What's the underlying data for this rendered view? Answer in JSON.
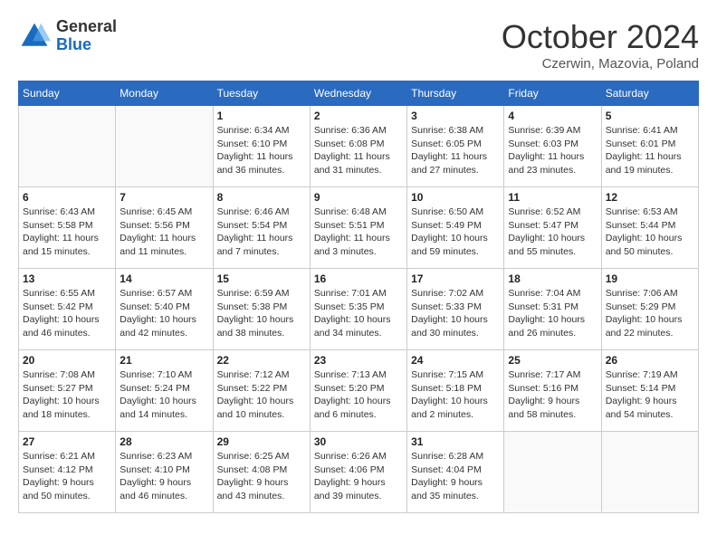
{
  "logo": {
    "general": "General",
    "blue": "Blue"
  },
  "header": {
    "month": "October 2024",
    "location": "Czerwin, Mazovia, Poland"
  },
  "weekdays": [
    "Sunday",
    "Monday",
    "Tuesday",
    "Wednesday",
    "Thursday",
    "Friday",
    "Saturday"
  ],
  "weeks": [
    [
      {
        "day": "",
        "info": ""
      },
      {
        "day": "",
        "info": ""
      },
      {
        "day": "1",
        "info": "Sunrise: 6:34 AM\nSunset: 6:10 PM\nDaylight: 11 hours and 36 minutes."
      },
      {
        "day": "2",
        "info": "Sunrise: 6:36 AM\nSunset: 6:08 PM\nDaylight: 11 hours and 31 minutes."
      },
      {
        "day": "3",
        "info": "Sunrise: 6:38 AM\nSunset: 6:05 PM\nDaylight: 11 hours and 27 minutes."
      },
      {
        "day": "4",
        "info": "Sunrise: 6:39 AM\nSunset: 6:03 PM\nDaylight: 11 hours and 23 minutes."
      },
      {
        "day": "5",
        "info": "Sunrise: 6:41 AM\nSunset: 6:01 PM\nDaylight: 11 hours and 19 minutes."
      }
    ],
    [
      {
        "day": "6",
        "info": "Sunrise: 6:43 AM\nSunset: 5:58 PM\nDaylight: 11 hours and 15 minutes."
      },
      {
        "day": "7",
        "info": "Sunrise: 6:45 AM\nSunset: 5:56 PM\nDaylight: 11 hours and 11 minutes."
      },
      {
        "day": "8",
        "info": "Sunrise: 6:46 AM\nSunset: 5:54 PM\nDaylight: 11 hours and 7 minutes."
      },
      {
        "day": "9",
        "info": "Sunrise: 6:48 AM\nSunset: 5:51 PM\nDaylight: 11 hours and 3 minutes."
      },
      {
        "day": "10",
        "info": "Sunrise: 6:50 AM\nSunset: 5:49 PM\nDaylight: 10 hours and 59 minutes."
      },
      {
        "day": "11",
        "info": "Sunrise: 6:52 AM\nSunset: 5:47 PM\nDaylight: 10 hours and 55 minutes."
      },
      {
        "day": "12",
        "info": "Sunrise: 6:53 AM\nSunset: 5:44 PM\nDaylight: 10 hours and 50 minutes."
      }
    ],
    [
      {
        "day": "13",
        "info": "Sunrise: 6:55 AM\nSunset: 5:42 PM\nDaylight: 10 hours and 46 minutes."
      },
      {
        "day": "14",
        "info": "Sunrise: 6:57 AM\nSunset: 5:40 PM\nDaylight: 10 hours and 42 minutes."
      },
      {
        "day": "15",
        "info": "Sunrise: 6:59 AM\nSunset: 5:38 PM\nDaylight: 10 hours and 38 minutes."
      },
      {
        "day": "16",
        "info": "Sunrise: 7:01 AM\nSunset: 5:35 PM\nDaylight: 10 hours and 34 minutes."
      },
      {
        "day": "17",
        "info": "Sunrise: 7:02 AM\nSunset: 5:33 PM\nDaylight: 10 hours and 30 minutes."
      },
      {
        "day": "18",
        "info": "Sunrise: 7:04 AM\nSunset: 5:31 PM\nDaylight: 10 hours and 26 minutes."
      },
      {
        "day": "19",
        "info": "Sunrise: 7:06 AM\nSunset: 5:29 PM\nDaylight: 10 hours and 22 minutes."
      }
    ],
    [
      {
        "day": "20",
        "info": "Sunrise: 7:08 AM\nSunset: 5:27 PM\nDaylight: 10 hours and 18 minutes."
      },
      {
        "day": "21",
        "info": "Sunrise: 7:10 AM\nSunset: 5:24 PM\nDaylight: 10 hours and 14 minutes."
      },
      {
        "day": "22",
        "info": "Sunrise: 7:12 AM\nSunset: 5:22 PM\nDaylight: 10 hours and 10 minutes."
      },
      {
        "day": "23",
        "info": "Sunrise: 7:13 AM\nSunset: 5:20 PM\nDaylight: 10 hours and 6 minutes."
      },
      {
        "day": "24",
        "info": "Sunrise: 7:15 AM\nSunset: 5:18 PM\nDaylight: 10 hours and 2 minutes."
      },
      {
        "day": "25",
        "info": "Sunrise: 7:17 AM\nSunset: 5:16 PM\nDaylight: 9 hours and 58 minutes."
      },
      {
        "day": "26",
        "info": "Sunrise: 7:19 AM\nSunset: 5:14 PM\nDaylight: 9 hours and 54 minutes."
      }
    ],
    [
      {
        "day": "27",
        "info": "Sunrise: 6:21 AM\nSunset: 4:12 PM\nDaylight: 9 hours and 50 minutes."
      },
      {
        "day": "28",
        "info": "Sunrise: 6:23 AM\nSunset: 4:10 PM\nDaylight: 9 hours and 46 minutes."
      },
      {
        "day": "29",
        "info": "Sunrise: 6:25 AM\nSunset: 4:08 PM\nDaylight: 9 hours and 43 minutes."
      },
      {
        "day": "30",
        "info": "Sunrise: 6:26 AM\nSunset: 4:06 PM\nDaylight: 9 hours and 39 minutes."
      },
      {
        "day": "31",
        "info": "Sunrise: 6:28 AM\nSunset: 4:04 PM\nDaylight: 9 hours and 35 minutes."
      },
      {
        "day": "",
        "info": ""
      },
      {
        "day": "",
        "info": ""
      }
    ]
  ]
}
